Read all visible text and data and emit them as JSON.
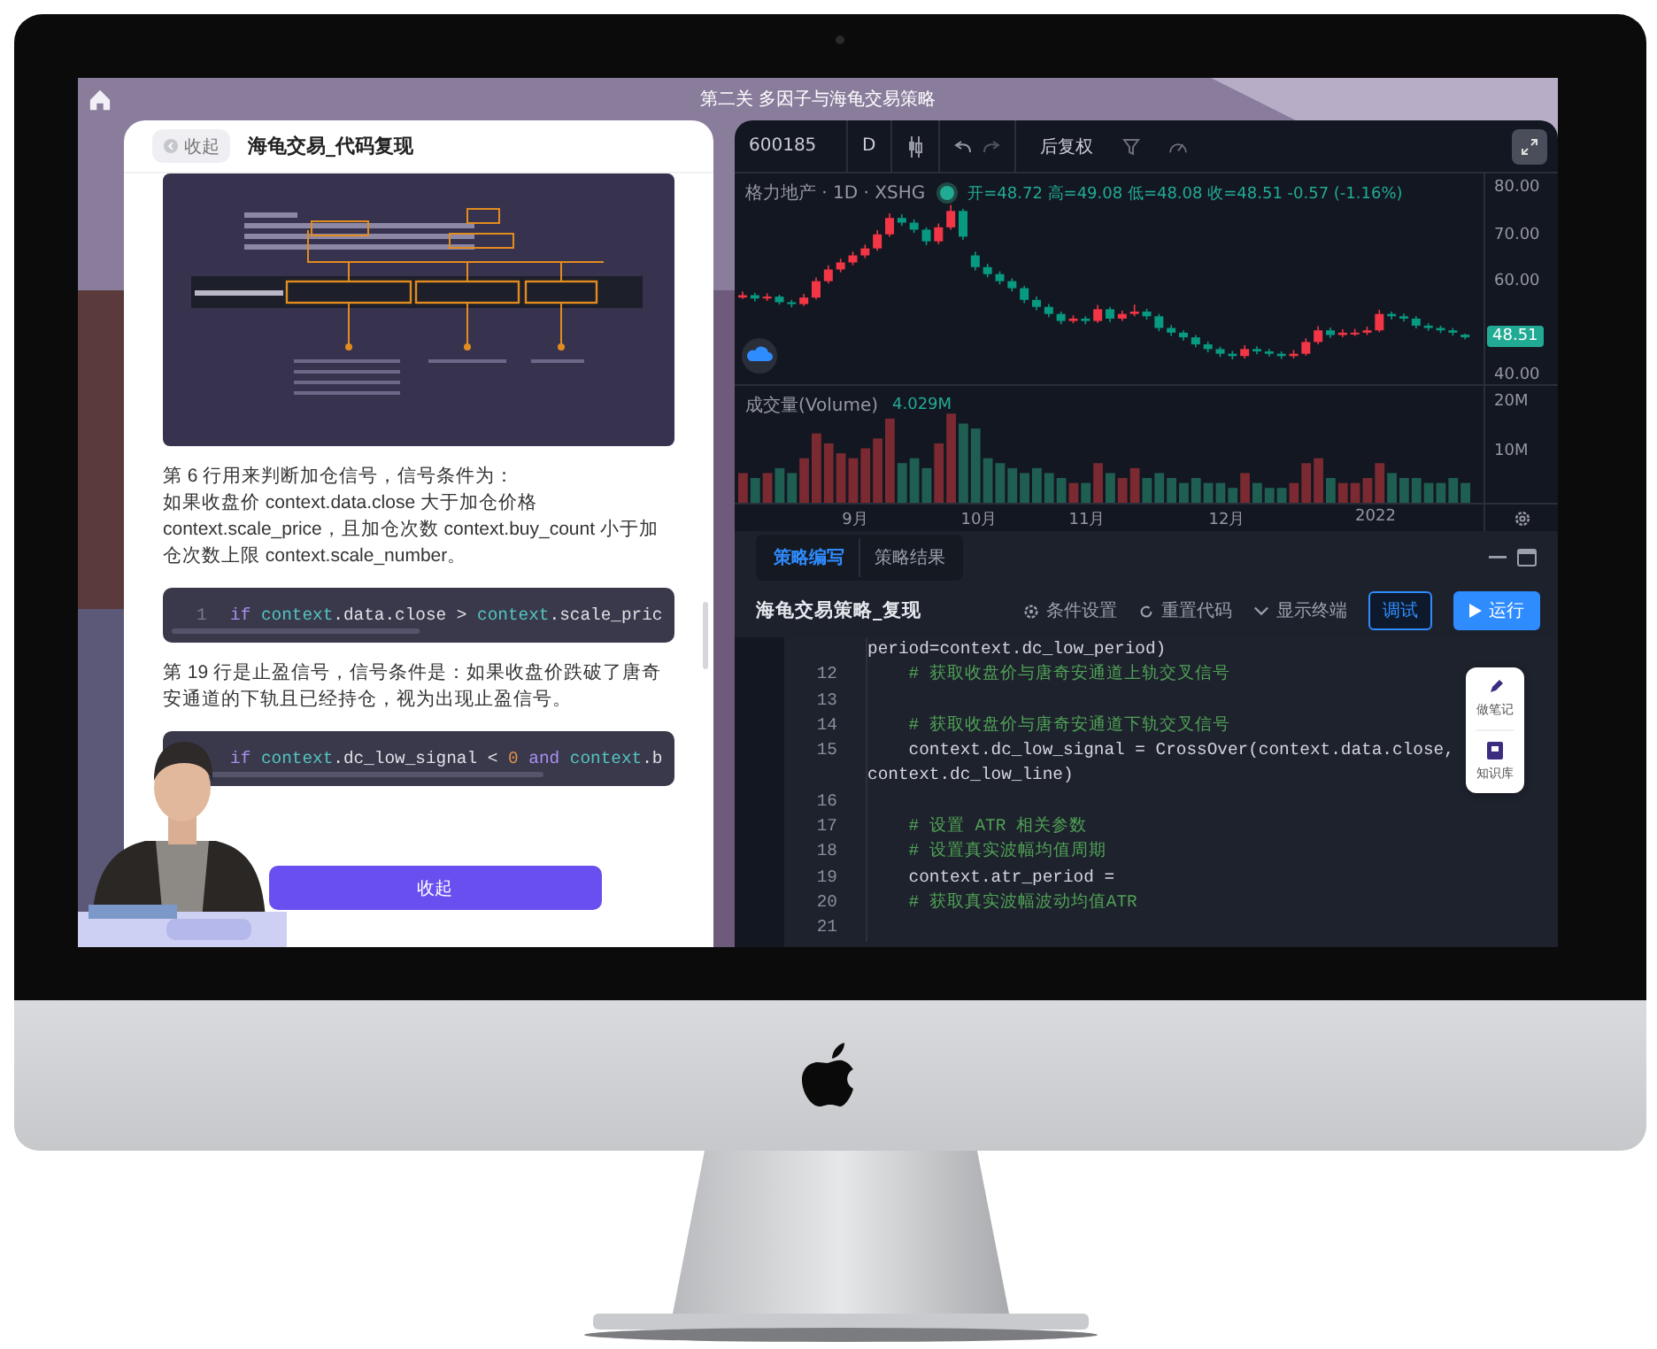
{
  "screen_title": "第二关 多因子与海龟交易策略",
  "lesson_panel": {
    "collapse_button": "收起",
    "title": "海龟交易_代码复现",
    "blocks": [
      {
        "kind": "figure"
      },
      {
        "kind": "paragraph",
        "lines": [
          "第 6 行用来判断加仓信号，信号条件为：",
          "如果收盘价 context.data.close 大于加仓价格 context.scale_price，且加仓次数 context.buy_count 小于加仓次数上限 context.scale_number。"
        ]
      },
      {
        "kind": "code",
        "line_number": "1",
        "tokens": [
          {
            "kind": "keyword",
            "text": "if "
          },
          {
            "kind": "name",
            "text": "context"
          },
          {
            "kind": "plain",
            "text": ".data.close > "
          },
          {
            "kind": "name",
            "text": "context"
          },
          {
            "kind": "plain",
            "text": ".scale_pric"
          }
        ]
      },
      {
        "kind": "paragraph",
        "lines": [
          "第 19 行是止盈信号，信号条件是：如果收盘价跌破了唐奇安通道的下轨且已经持仓，视为出现止盈信号。"
        ]
      },
      {
        "kind": "code",
        "tokens": [
          {
            "kind": "keyword",
            "text": "if "
          },
          {
            "kind": "name",
            "text": "context"
          },
          {
            "kind": "plain",
            "text": ".dc_low_signal < "
          },
          {
            "kind": "number",
            "text": "0"
          },
          {
            "kind": "keyword",
            "text": " and "
          },
          {
            "kind": "name",
            "text": "context"
          },
          {
            "kind": "plain",
            "text": ".b"
          }
        ]
      }
    ],
    "bottom_button": "收起"
  },
  "chart": {
    "symbol": "600185",
    "interval": "D",
    "adjust": "后复权",
    "price_pane": {
      "legend_name": "格力地产 · 1D · XSHG",
      "ohlc": "开=48.72 高=49.08 低=48.08 收=48.51 -0.57 (-1.16%)",
      "last_price": "48.51",
      "chart_data": {
        "type": "candlestick",
        "ylim": [
          38.5,
          83.5
        ],
        "yticks": [
          {
            "value": 80,
            "label": "80.00"
          },
          {
            "value": 70,
            "label": "70.00"
          },
          {
            "value": 60,
            "label": "60.00"
          },
          {
            "value": 40,
            "label": "40.00"
          }
        ],
        "ohlc": [
          [
            57.0,
            58.3,
            56.7,
            57.5
          ],
          [
            57.5,
            58.0,
            56.2,
            56.8
          ],
          [
            56.8,
            57.9,
            56.3,
            57.2
          ],
          [
            57.2,
            57.6,
            55.5,
            56.0
          ],
          [
            56.0,
            56.5,
            54.9,
            55.6
          ],
          [
            55.6,
            57.8,
            55.2,
            57.0
          ],
          [
            57.0,
            61.3,
            56.6,
            60.5
          ],
          [
            60.5,
            63.9,
            60.0,
            63.0
          ],
          [
            63.0,
            65.3,
            62.4,
            64.5
          ],
          [
            64.5,
            66.8,
            63.9,
            66.0
          ],
          [
            66.0,
            68.3,
            65.4,
            67.5
          ],
          [
            67.5,
            71.4,
            67.0,
            70.5
          ],
          [
            70.5,
            75.0,
            70.0,
            74.0
          ],
          [
            74.0,
            74.8,
            72.3,
            73.0
          ],
          [
            73.0,
            73.7,
            70.8,
            71.5
          ],
          [
            71.5,
            72.0,
            68.2,
            69.0
          ],
          [
            69.0,
            72.8,
            68.4,
            72.0
          ],
          [
            72.0,
            76.8,
            71.5,
            75.5
          ],
          [
            75.5,
            76.0,
            69.3,
            70.0
          ],
          [
            66.0,
            66.8,
            62.8,
            63.5
          ],
          [
            63.5,
            64.2,
            61.3,
            62.0
          ],
          [
            62.0,
            62.6,
            59.8,
            60.5
          ],
          [
            60.5,
            61.1,
            58.3,
            59.0
          ],
          [
            59.0,
            59.5,
            55.8,
            56.5
          ],
          [
            56.5,
            57.2,
            54.3,
            55.0
          ],
          [
            55.0,
            55.6,
            52.8,
            53.5
          ],
          [
            53.5,
            54.0,
            51.3,
            52.0
          ],
          [
            52.0,
            53.2,
            51.5,
            52.5
          ],
          [
            52.5,
            53.0,
            51.3,
            52.0
          ],
          [
            52.0,
            55.4,
            51.6,
            54.5
          ],
          [
            54.5,
            55.0,
            51.8,
            52.5
          ],
          [
            52.5,
            54.2,
            52.0,
            53.5
          ],
          [
            53.5,
            55.5,
            53.0,
            54.0
          ],
          [
            54.0,
            54.6,
            52.3,
            53.0
          ],
          [
            53.0,
            53.5,
            49.8,
            50.5
          ],
          [
            50.5,
            51.1,
            48.8,
            49.5
          ],
          [
            49.5,
            50.0,
            47.8,
            48.5
          ],
          [
            48.5,
            49.0,
            46.4,
            47.0
          ],
          [
            47.0,
            47.6,
            45.3,
            46.0
          ],
          [
            46.0,
            46.5,
            44.3,
            45.0
          ],
          [
            45.0,
            45.6,
            43.8,
            44.5
          ],
          [
            44.5,
            46.8,
            44.0,
            46.0
          ],
          [
            46.0,
            46.6,
            44.9,
            45.5
          ],
          [
            45.5,
            46.0,
            44.4,
            45.0
          ],
          [
            45.0,
            45.5,
            43.9,
            44.5
          ],
          [
            44.5,
            45.8,
            44.0,
            45.0
          ],
          [
            45.0,
            48.3,
            44.6,
            47.5
          ],
          [
            47.5,
            50.9,
            47.0,
            50.0
          ],
          [
            50.0,
            50.6,
            48.4,
            49.0
          ],
          [
            49.0,
            50.2,
            48.5,
            49.5
          ],
          [
            49.5,
            50.3,
            48.8,
            49.5
          ],
          [
            49.5,
            50.8,
            49.0,
            50.0
          ],
          [
            50.0,
            54.4,
            49.6,
            53.5
          ],
          [
            53.5,
            54.0,
            52.3,
            53.0
          ],
          [
            53.0,
            53.6,
            51.9,
            52.5
          ],
          [
            52.5,
            53.0,
            50.4,
            51.0
          ],
          [
            51.0,
            51.5,
            49.9,
            50.5
          ],
          [
            50.5,
            51.0,
            49.4,
            50.0
          ],
          [
            50.0,
            50.5,
            48.9,
            49.5
          ],
          [
            49.08,
            49.3,
            48.08,
            48.51
          ]
        ]
      }
    },
    "volume_pane": {
      "volume_label": "成交量(Volume)",
      "volume_value": "4.029M",
      "chart_data": {
        "type": "bar",
        "ylim": [
          0,
          23.6
        ],
        "yticks": [
          {
            "value": 20,
            "label": "20M"
          },
          {
            "value": 10,
            "label": "10M"
          }
        ],
        "values": [
          6,
          5,
          6,
          7,
          6,
          9,
          14,
          12,
          10,
          9,
          11,
          13,
          17,
          8,
          9,
          7,
          12,
          18,
          16,
          15,
          9,
          8,
          7,
          6,
          7,
          6,
          5,
          4,
          4,
          8,
          6,
          5,
          7,
          5,
          6,
          5,
          4,
          5,
          4,
          4,
          3,
          6,
          4,
          3,
          3,
          4,
          8,
          9,
          5,
          4,
          4,
          5,
          8,
          6,
          5,
          5,
          4,
          4,
          5,
          4
        ]
      }
    },
    "months": [
      "9月",
      "10月",
      "11月",
      "12月",
      "2022"
    ]
  },
  "tabs": [
    {
      "label": "策略编写",
      "selected": true
    },
    {
      "label": "策略结果",
      "selected": false
    }
  ],
  "editor": {
    "title": "海龟交易策略_复现",
    "actions": [
      {
        "kind": "settings",
        "label": "条件设置"
      },
      {
        "kind": "reset",
        "label": "重置代码"
      },
      {
        "kind": "toggle",
        "label": "显示终端"
      }
    ],
    "debug_button": "调试",
    "run_button": "运行",
    "lines": [
      {
        "kind": "code",
        "text": "period=context.dc_low_period)"
      },
      {
        "number": "12",
        "kind": "comment",
        "text": "    # 获取收盘价与唐奇安通道上轨交叉信号"
      },
      {
        "number": "13",
        "kind": "blank"
      },
      {
        "number": "14",
        "kind": "comment",
        "text": "    # 获取收盘价与唐奇安通道下轨交叉信号"
      },
      {
        "number": "15",
        "kind": "code",
        "text": "    context.dc_low_signal = CrossOver(context.data.close, context.dc_low_line)"
      },
      {
        "number": "16",
        "kind": "blank"
      },
      {
        "number": "17",
        "kind": "comment",
        "text": "    # 设置 ATR 相关参数"
      },
      {
        "number": "18",
        "kind": "comment",
        "text": "    # 设置真实波幅均值周期"
      },
      {
        "number": "19",
        "kind": "code",
        "text": "    context.atr_period = "
      },
      {
        "number": "20",
        "kind": "comment",
        "text": "    # 获取真实波幅波动均值ATR"
      },
      {
        "number": "21",
        "kind": "blank"
      }
    ]
  },
  "side_tools": [
    {
      "kind": "note",
      "label": "做笔记"
    },
    {
      "kind": "library",
      "label": "知识库"
    }
  ]
}
